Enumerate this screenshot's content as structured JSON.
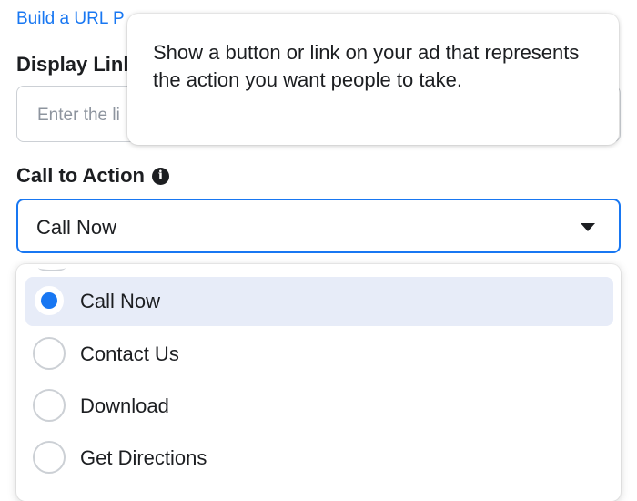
{
  "url_builder": {
    "label": "Build a URL P"
  },
  "display_link": {
    "label": "Display Linl",
    "placeholder": "Enter the li"
  },
  "tooltip": {
    "text": "Show a button or link on your ad that represents the action you want people to take."
  },
  "call_to_action": {
    "label": "Call to Action",
    "info_icon": "info-icon",
    "selected_value": "Call Now",
    "dropdown_icon": "caret-down-icon",
    "options": [
      {
        "label": "Call Now",
        "selected": true
      },
      {
        "label": "Contact Us",
        "selected": false
      },
      {
        "label": "Download",
        "selected": false
      },
      {
        "label": "Get Directions",
        "selected": false
      }
    ]
  },
  "colors": {
    "accent": "#1877f2",
    "selected_row": "#e7ecf8",
    "text": "#1c1e21",
    "placeholder": "#8d949e"
  }
}
